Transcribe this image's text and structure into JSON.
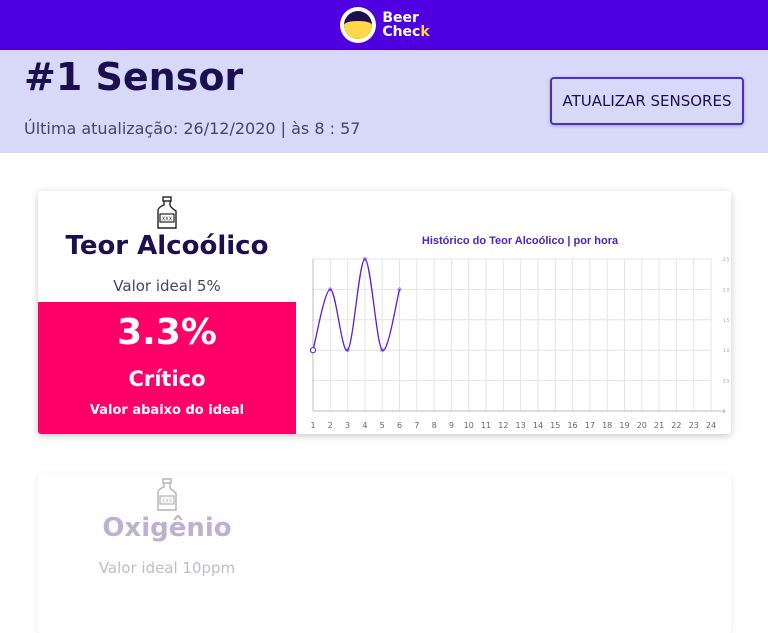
{
  "brand": {
    "line1": "Beer",
    "line2a": "Chec",
    "line2b": "k"
  },
  "header": {
    "title": "#1 Sensor",
    "subtitle": "Última atualização: 26/12/2020 | às 8 : 57",
    "refresh_label": "ATUALIZAR SENSORES"
  },
  "sensors": [
    {
      "name": "Teor Alcoólico",
      "ideal": "Valor ideal 5%",
      "value": "3.3%",
      "status": "Crítico",
      "status_desc": "Valor abaixo do ideal",
      "status_color": "#ff0068"
    },
    {
      "name": "Oxigênio",
      "ideal": "Valor ideal 10ppm"
    }
  ],
  "colors": {
    "brand": "#4f00e0",
    "header_bg": "#d8d8f8",
    "line": "#5a1fd6",
    "critical": "#ff0068"
  },
  "chart_data": {
    "type": "line",
    "title": "Histórico do Teor Alcoólico | por hora",
    "x": [
      1,
      2,
      3,
      4,
      5,
      6
    ],
    "values": [
      1.0,
      2.0,
      1.0,
      2.5,
      1.0,
      2.0
    ],
    "x_ticks": [
      "1",
      "2",
      "3",
      "4",
      "5",
      "6",
      "7",
      "8",
      "9",
      "10",
      "11",
      "12",
      "13",
      "14",
      "15",
      "16",
      "17",
      "18",
      "19",
      "20",
      "21",
      "22",
      "23",
      "24"
    ],
    "y_ticks": [
      "0",
      "0.5",
      "1.0",
      "1.5",
      "2.0",
      "2.5"
    ],
    "xlim": [
      1,
      24
    ],
    "ylim": [
      0,
      2.5
    ],
    "grid": true,
    "y_axis_side": "right"
  }
}
